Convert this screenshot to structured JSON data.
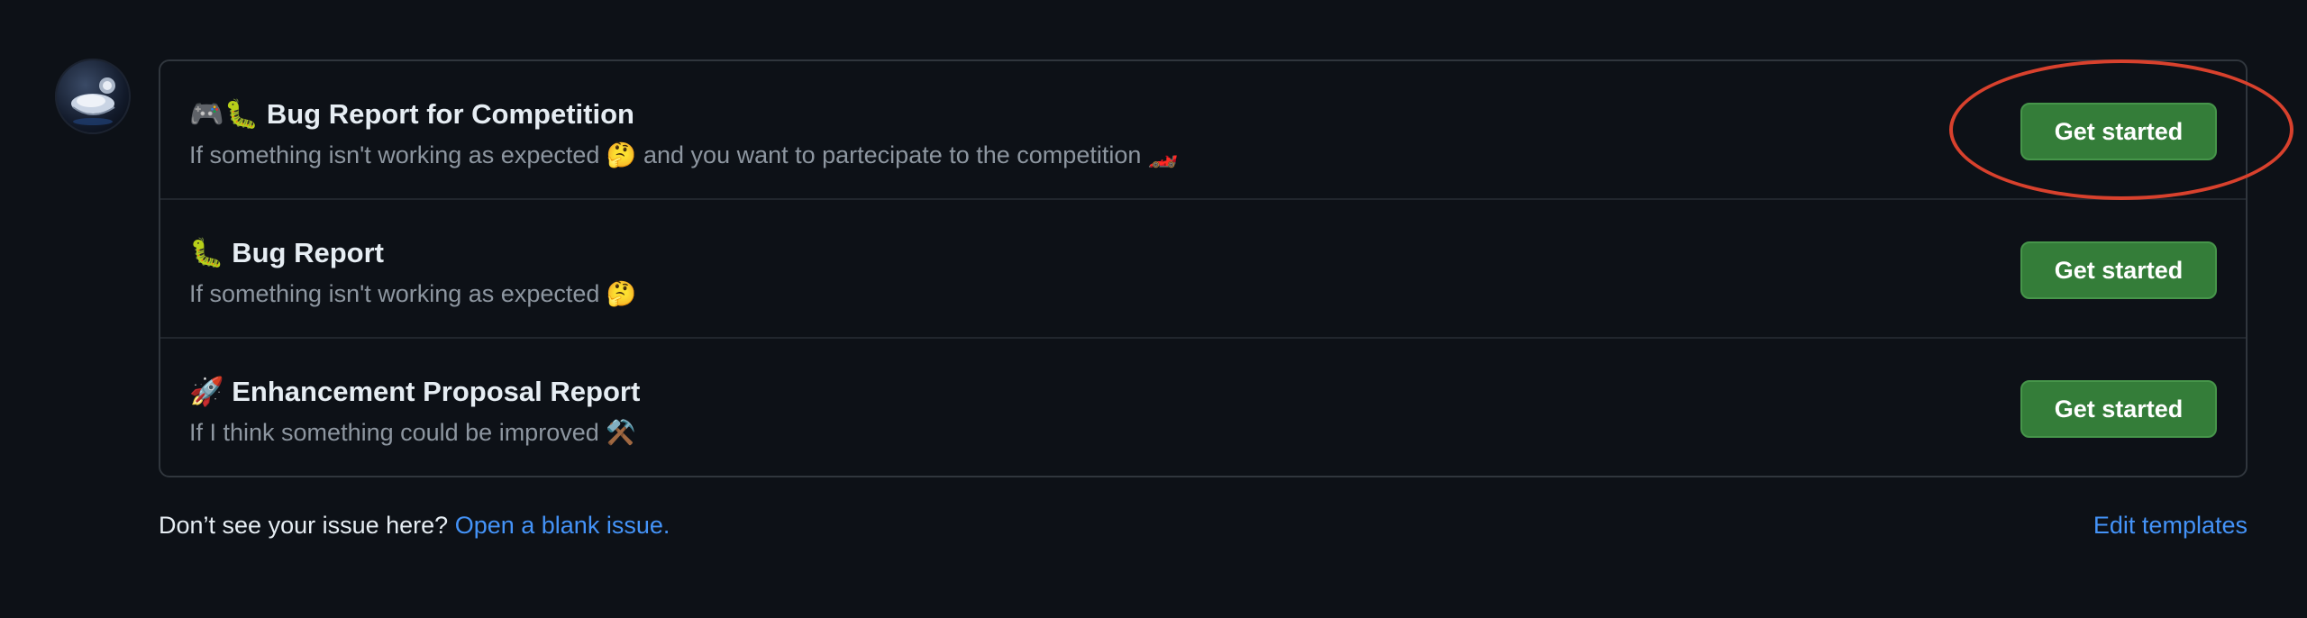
{
  "templates": [
    {
      "emoji": "🎮🐛",
      "title": "Bug Report for Competition",
      "description": "If something isn't working as expected 🤔 and you want to partecipate to the competition 🏎️",
      "button_label": "Get started"
    },
    {
      "emoji": "🐛",
      "title": "Bug Report",
      "description": "If something isn't working as expected 🤔",
      "button_label": "Get started"
    },
    {
      "emoji": "🚀",
      "title": "Enhancement Proposal Report",
      "description": "If I think something could be improved ⚒️",
      "button_label": "Get started"
    }
  ],
  "footer": {
    "prompt": "Don’t see your issue here?",
    "blank_issue_link": "Open a blank issue.",
    "edit_templates_link": "Edit templates"
  },
  "colors": {
    "background": "#0d1117",
    "button": "#347d39",
    "link": "#4493f8",
    "annotation": "#d8412d"
  }
}
